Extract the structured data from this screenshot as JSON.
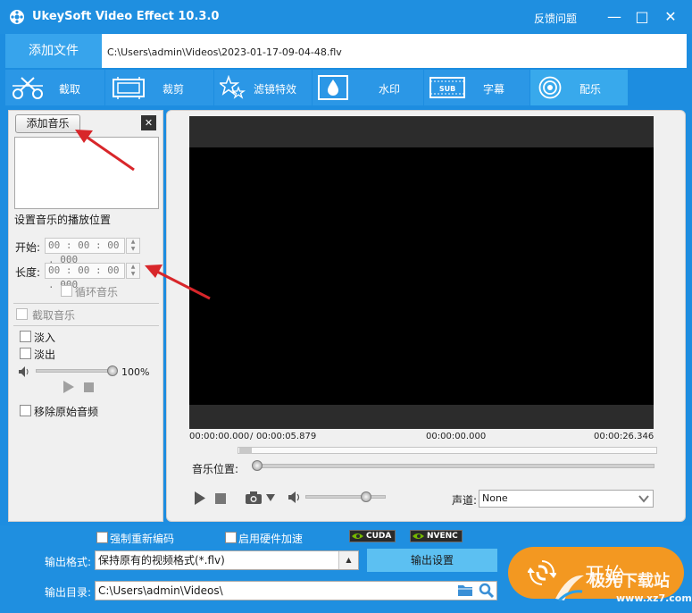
{
  "window": {
    "title": "UkeySoft Video Effect 10.3.0",
    "feedback": "反馈问题",
    "minimize": "—",
    "maximize": "□",
    "close": "✕"
  },
  "file": {
    "add_file": "添加文件",
    "path": "C:\\Users\\admin\\Videos\\2023-01-17-09-04-48.flv"
  },
  "tabs": [
    {
      "label": "截取",
      "icon": "scissors-icon"
    },
    {
      "label": "裁剪",
      "icon": "crop-icon"
    },
    {
      "label": "滤镜特效",
      "icon": "stars-icon"
    },
    {
      "label": "水印",
      "icon": "watermark-icon"
    },
    {
      "label": "字幕",
      "icon": "subtitle-icon"
    },
    {
      "label": "配乐",
      "icon": "audio-wave-icon"
    }
  ],
  "music_panel": {
    "add_music": "添加音乐",
    "close": "✕",
    "position_title": "设置音乐的播放位置",
    "start_label": "开始:",
    "start_value": "00 : 00 : 00 . 000",
    "length_label": "长度:",
    "length_value": "00 : 00 : 00 . 000",
    "loop": "循环音乐",
    "trim": "截取音乐",
    "fade_in": "淡入",
    "fade_out": "淡出",
    "volume": "100%",
    "volume_level": 1.0,
    "remove_original": "移除原始音频"
  },
  "preview": {
    "time_start": "00:00:00.000",
    "time_sep": "/",
    "time_end_sel": "00:00:05.879",
    "time_current": "00:00:00.000",
    "time_total": "00:00:26.346",
    "music_position": "音乐位置:",
    "channel_label": "声道:",
    "channel_value": "None",
    "volume_level": 0.75
  },
  "bottom": {
    "reencode": "强制重新编码",
    "hw_accel": "启用硬件加速",
    "cuda": "CUDA",
    "nvenc": "NVENC",
    "format_label": "输出格式:",
    "format_value": "保持原有的视频格式(*.flv)",
    "output_settings": "输出设置",
    "dir_label": "输出目录:",
    "dir_value": "C:\\Users\\admin\\Videos\\",
    "start": "开始",
    "watermark_text": "极光下载站",
    "watermark_url": "www.xz7.com"
  },
  "colors": {
    "brand_blue": "#1f8fe0",
    "tab_blue": "#2b97e6",
    "tab_active": "#38a9ec",
    "start_orange": "#f39821",
    "arrow_red": "#d8262a"
  }
}
